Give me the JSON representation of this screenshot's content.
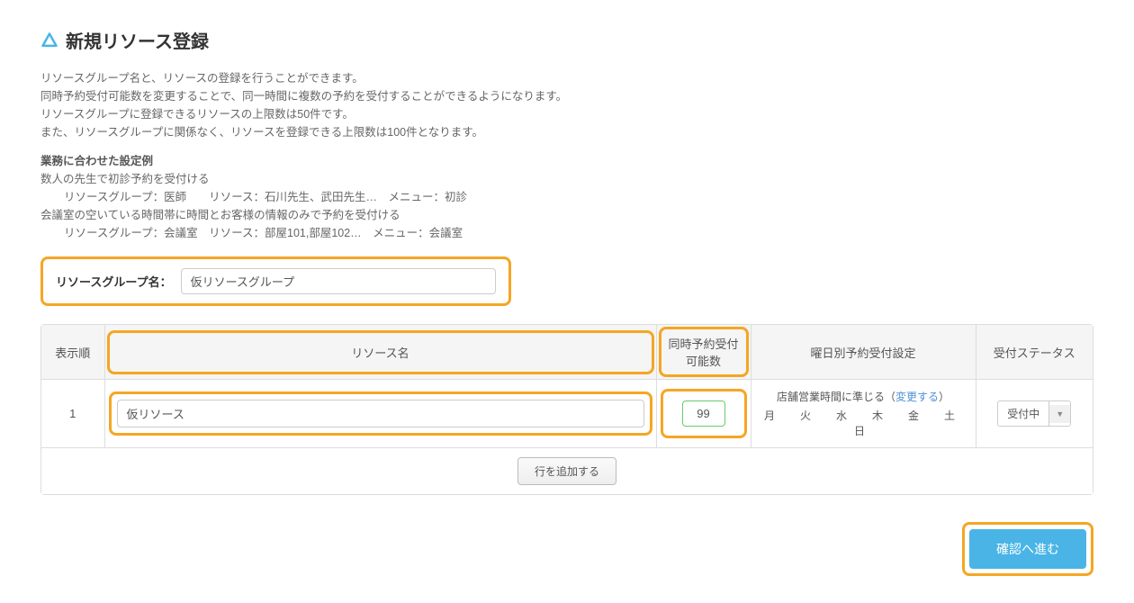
{
  "header": {
    "title": "新規リソース登録"
  },
  "description": {
    "line1": "リソースグループ名と、リソースの登録を行うことができます。",
    "line2": "同時予約受付可能数を変更することで、同一時間に複数の予約を受付することができるようになります。",
    "line3": "リソースグループに登録できるリソースの上限数は50件です。",
    "line4": "また、リソースグループに関係なく、リソースを登録できる上限数は100件となります。"
  },
  "example": {
    "title": "業務に合わせた設定例",
    "line1": "数人の先生で初診予約を受付ける",
    "line2": "リソースグループ：医師　　リソース：石川先生、武田先生…　メニュー：初診",
    "line3": "会議室の空いている時間帯に時間とお客様の情報のみで予約を受付ける",
    "line4": "リソースグループ：会議室　リソース：部屋101,部屋102…　メニュー：会議室"
  },
  "groupName": {
    "label": "リソースグループ名：",
    "value": "仮リソースグループ"
  },
  "table": {
    "headers": {
      "order": "表示順",
      "name": "リソース名",
      "capacity_line1": "同時予約受付",
      "capacity_line2": "可能数",
      "weekday": "曜日別予約受付設定",
      "status": "受付ステータス"
    },
    "row": {
      "order": "1",
      "name": "仮リソース",
      "capacity": "99",
      "weekday_text": "店舗営業時間に準じる（",
      "weekday_link": "変更する",
      "weekday_text_end": "）",
      "days": "月　火　水　木　金　土　日",
      "status": "受付中"
    },
    "addRow": "行を追加する"
  },
  "footer": {
    "confirm": "確認へ進む"
  }
}
